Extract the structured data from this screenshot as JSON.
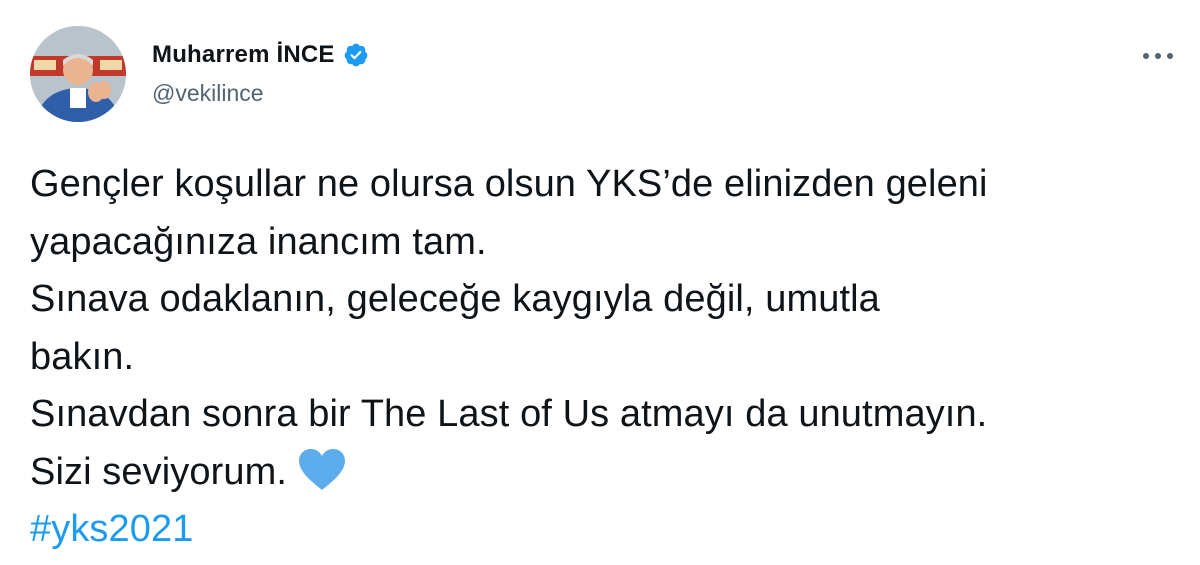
{
  "author": {
    "display_name": "Muharrem İNCE",
    "handle": "@vekilince",
    "verified": true
  },
  "tweet": {
    "lines": [
      "Gençler koşullar ne olursa olsun YKS’de elinizden geleni",
      "yapacağınıza inancım tam.",
      "Sınava odaklanın, geleceğe kaygıyla değil, umutla",
      "bakın.",
      "Sınavdan sonra bir The Last of Us atmayı da unutmayın.",
      "Sizi seviyorum."
    ],
    "emoji": "blue-heart-icon",
    "hashtag": "#yks2021"
  },
  "colors": {
    "text": "#0f1419",
    "secondary": "#536471",
    "link": "#1d9bf0",
    "verified": "#1d9bf0",
    "heart": "#5dadec"
  },
  "icons": {
    "menu": "more-horizontal-icon",
    "badge": "verified-badge-icon"
  }
}
